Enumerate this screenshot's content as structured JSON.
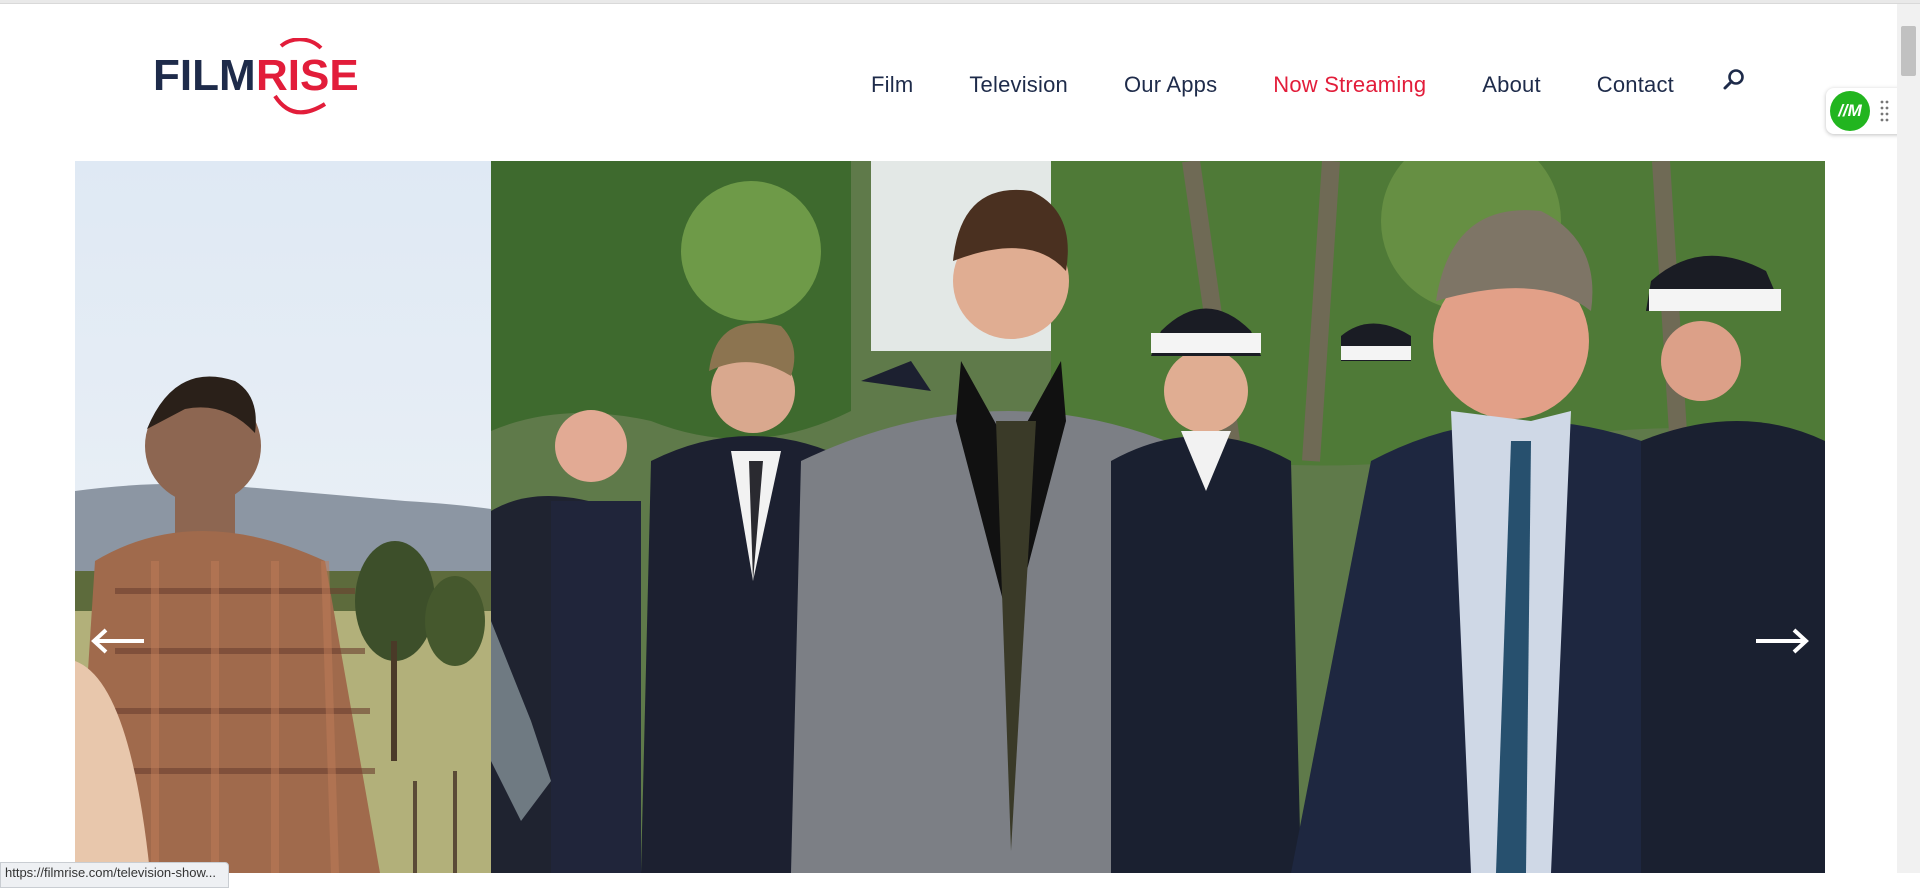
{
  "header": {
    "logo_text_part1": "FILM",
    "logo_text_part2": "RISE",
    "nav": [
      {
        "label": "Film"
      },
      {
        "label": "Television"
      },
      {
        "label": "Our Apps"
      },
      {
        "label": "Now Streaming",
        "active": true
      },
      {
        "label": "About"
      },
      {
        "label": "Contact"
      }
    ],
    "search_icon": "search-icon"
  },
  "colors": {
    "brand_navy": "#1e2b4a",
    "brand_red": "#e21d3a",
    "widget_green": "#22b51f"
  },
  "slider": {
    "prev_icon": "arrow-left-icon",
    "next_icon": "arrow-right-icon"
  },
  "widget": {
    "badge": "//M"
  },
  "status_bar": {
    "url": "https://filmrise.com/television-show..."
  }
}
